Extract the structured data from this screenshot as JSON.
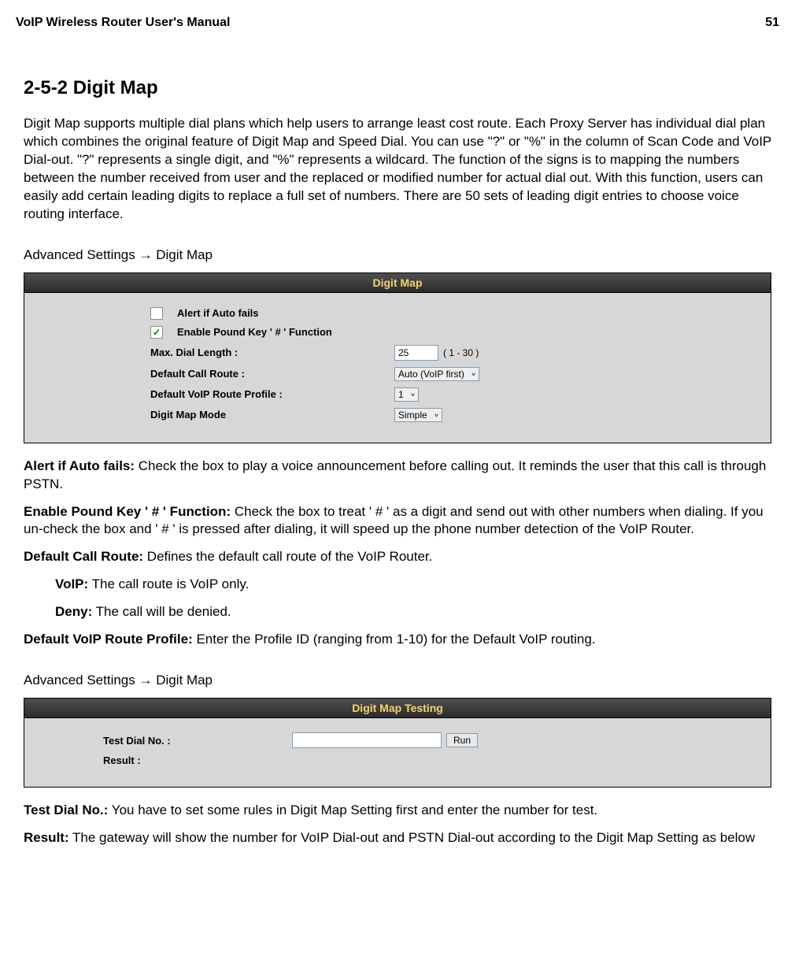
{
  "header": {
    "title": "VoIP Wireless Router User's Manual",
    "page_number": "51"
  },
  "section": {
    "heading": "2-5-2 Digit Map",
    "intro": "Digit Map supports multiple dial plans which help users to arrange least cost route. Each Proxy Server has individual dial plan which combines the original feature of Digit Map and Speed Dial. You can use \"?\" or \"%\" in the column of Scan Code and VoIP Dial-out. \"?\" represents a single digit, and \"%\" represents a wildcard. The function of the signs is to mapping the numbers between the number received from user and the replaced or modified number for actual dial out. With this function, users can easily add certain leading digits to replace a full set of numbers. There are 50 sets of leading digit entries to choose voice routing interface.",
    "navpath1": "Advanced Settings  →  Digit Map",
    "navpath2": "Advanced Settings  →  Digit Map"
  },
  "panel1": {
    "title": "Digit Map",
    "alert_label": "Alert if Auto fails",
    "alert_checked": false,
    "pound_label": "Enable Pound Key ' # ' Function",
    "pound_checked": true,
    "max_dial_label": "Max. Dial Length :",
    "max_dial_value": "25",
    "max_dial_range": "( 1 - 30 )",
    "default_call_route_label": "Default Call Route :",
    "default_call_route_value": "Auto (VoIP first)",
    "default_voip_profile_label": "Default VoIP Route Profile :",
    "default_voip_profile_value": "1",
    "digit_map_mode_label": "Digit Map Mode",
    "digit_map_mode_value": "Simple"
  },
  "descriptions1": {
    "alert_title": "Alert if Auto fails:",
    "alert_body": " Check the box to play a voice announcement before calling out. It reminds the user that this call is through PSTN.",
    "pound_title": "Enable Pound Key ' # ' Function:",
    "pound_body": " Check the box to treat ' # ' as a digit and send out with other numbers when dialing. If you un-check the box and ' # ' is pressed after dialing, it will speed up the phone number detection of the VoIP Router.",
    "route_title": "Default Call Route:",
    "route_body": " Defines the default call route of the VoIP Router.",
    "voip_title": "VoIP:",
    "voip_body": " The call route is VoIP only.",
    "deny_title": "Deny:",
    "deny_body": " The call will be denied.",
    "profile_title": "Default VoIP Route Profile:",
    "profile_body": " Enter the Profile ID (ranging from 1-10) for the Default VoIP routing."
  },
  "panel2": {
    "title": "Digit Map Testing",
    "test_label": "Test Dial No. :",
    "test_value": "",
    "run_label": "Run",
    "result_label": "Result :"
  },
  "descriptions2": {
    "test_title": "Test Dial No.:",
    "test_body": " You have to set some rules in Digit Map Setting first and enter the number for test.",
    "result_title": "Result:",
    "result_body": " The gateway will show the number for VoIP Dial-out and PSTN Dial-out according to the Digit Map Setting as below"
  }
}
